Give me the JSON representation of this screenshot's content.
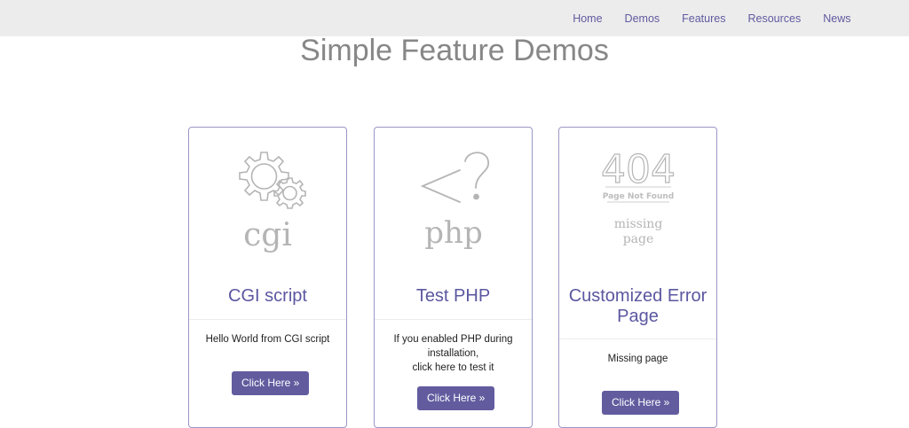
{
  "nav": {
    "items": [
      {
        "label": "Home"
      },
      {
        "label": "Demos"
      },
      {
        "label": "Features"
      },
      {
        "label": "Resources"
      },
      {
        "label": "News"
      }
    ]
  },
  "page": {
    "title": "Simple Feature Demos"
  },
  "cards": [
    {
      "icon_name": "gears-icon",
      "icon_text": "cgi",
      "title_line1": "CGI script",
      "text_lines": [
        "Hello World from CGI script"
      ],
      "button_label": "Click Here »"
    },
    {
      "icon_name": "php-icon",
      "icon_text": "php",
      "title_line1": "Test PHP",
      "text_lines": [
        "If you enabled PHP during",
        "installation,",
        "click here to test it"
      ],
      "button_label": "Click Here »"
    },
    {
      "icon_name": "404-page-icon",
      "icon_code": "404",
      "icon_caption": "Page Not Found",
      "icon_text_line1": "missing",
      "icon_text_line2": "page",
      "title_line1": "Customized Error",
      "title_line2": "Page",
      "text_lines": [
        "Missing page"
      ],
      "button_label": "Click Here »"
    }
  ],
  "colors": {
    "accent": "#625c9f",
    "title_purple": "#5b57a0",
    "nav_bg": "#ececec",
    "card_border": "#9b97c6",
    "icon_gray": "#b5b5b5"
  }
}
